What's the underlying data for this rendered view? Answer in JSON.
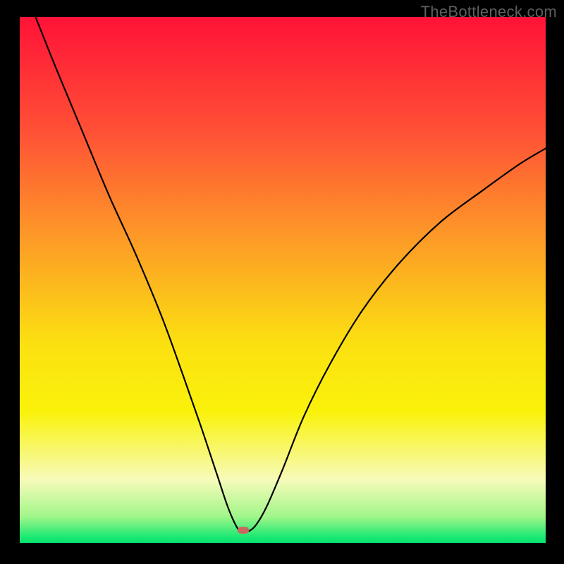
{
  "watermark": "TheBottleneck.com",
  "chart_data": {
    "type": "line",
    "title": "",
    "xlabel": "",
    "ylabel": "",
    "xlim": [
      0,
      100
    ],
    "ylim": [
      0,
      100
    ],
    "background_gradient": {
      "type": "vertical",
      "stops": [
        {
          "pos": 0.0,
          "color": "#ff1237"
        },
        {
          "pos": 0.22,
          "color": "#ff5136"
        },
        {
          "pos": 0.42,
          "color": "#fd9a27"
        },
        {
          "pos": 0.62,
          "color": "#fbe011"
        },
        {
          "pos": 0.75,
          "color": "#faf20a"
        },
        {
          "pos": 0.88,
          "color": "#f7fbba"
        },
        {
          "pos": 0.95,
          "color": "#a1f689"
        },
        {
          "pos": 0.99,
          "color": "#18e873"
        },
        {
          "pos": 1.0,
          "color": "#09e46d"
        }
      ]
    },
    "marker": {
      "x": 42.5,
      "y": 2.4,
      "color": "#c9695d",
      "approx_width": 2.2,
      "approx_height": 1.3
    },
    "series": [
      {
        "name": "curve",
        "color": "#000000",
        "points": [
          {
            "x": 3.0,
            "y": 100.0
          },
          {
            "x": 7.0,
            "y": 90.0
          },
          {
            "x": 12.0,
            "y": 78.0
          },
          {
            "x": 17.0,
            "y": 66.0
          },
          {
            "x": 22.0,
            "y": 55.0
          },
          {
            "x": 27.0,
            "y": 43.0
          },
          {
            "x": 31.0,
            "y": 32.0
          },
          {
            "x": 34.5,
            "y": 22.0
          },
          {
            "x": 37.5,
            "y": 13.0
          },
          {
            "x": 39.5,
            "y": 7.0
          },
          {
            "x": 41.0,
            "y": 3.5
          },
          {
            "x": 42.0,
            "y": 2.2
          },
          {
            "x": 43.5,
            "y": 2.2
          },
          {
            "x": 45.0,
            "y": 3.5
          },
          {
            "x": 47.0,
            "y": 7.0
          },
          {
            "x": 50.0,
            "y": 14.0
          },
          {
            "x": 54.0,
            "y": 24.0
          },
          {
            "x": 59.0,
            "y": 34.0
          },
          {
            "x": 65.0,
            "y": 44.0
          },
          {
            "x": 72.0,
            "y": 53.0
          },
          {
            "x": 80.0,
            "y": 61.0
          },
          {
            "x": 88.0,
            "y": 67.0
          },
          {
            "x": 95.0,
            "y": 72.0
          },
          {
            "x": 100.0,
            "y": 75.0
          }
        ]
      }
    ]
  }
}
